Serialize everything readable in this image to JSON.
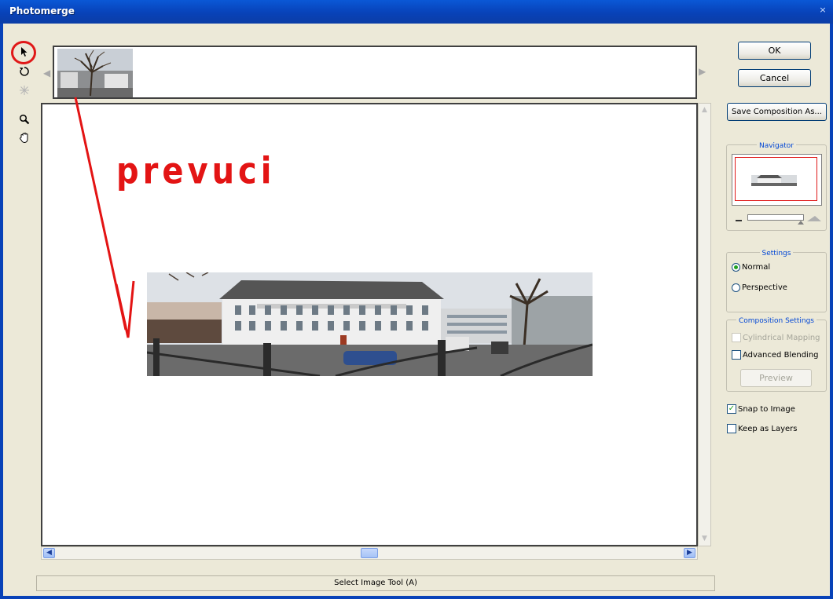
{
  "window": {
    "title": "Photomerge",
    "close_glyph": "×"
  },
  "tools": [
    {
      "name": "select-image-tool-icon"
    },
    {
      "name": "rotate-image-tool-icon"
    },
    {
      "name": "vanishing-point-tool-icon"
    },
    {
      "name": "zoom-tool-icon"
    },
    {
      "name": "hand-tool-icon"
    }
  ],
  "annotation": {
    "text": "prevuci",
    "color": "#e31414"
  },
  "buttons": {
    "ok": "OK",
    "cancel": "Cancel",
    "save_composition": "Save Composition As...",
    "preview": "Preview"
  },
  "navigator": {
    "label": "Navigator"
  },
  "settings": {
    "label": "Settings",
    "options": [
      "Normal",
      "Perspective"
    ],
    "selected": "Normal"
  },
  "composition_settings": {
    "label": "Composition Settings",
    "cylindrical_mapping": "Cylindrical Mapping",
    "cylindrical_checked": false,
    "advanced_blending": "Advanced Blending",
    "advanced_checked": false
  },
  "options": {
    "snap_to_image": "Snap to Image",
    "snap_checked": true,
    "keep_as_layers": "Keep as Layers",
    "keep_checked": false
  },
  "status": {
    "text": "Select Image Tool (A)"
  },
  "colors": {
    "titlebar": "#0842b8",
    "accent_label": "#0046d5",
    "highlight": "#e01818"
  }
}
